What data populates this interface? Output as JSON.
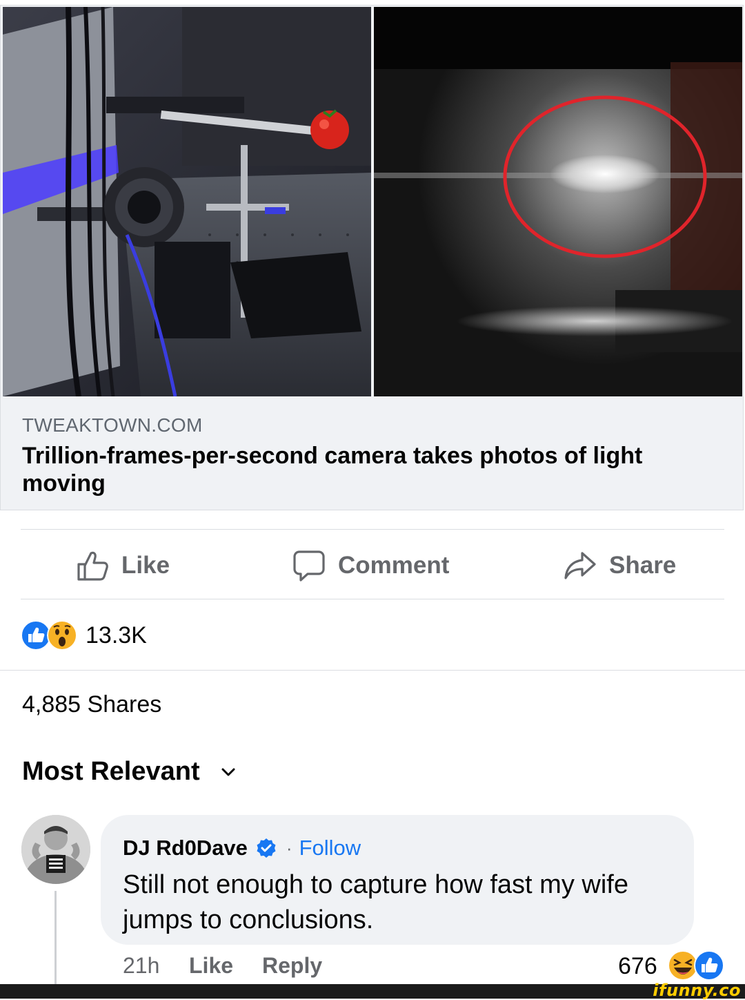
{
  "preview": {
    "domain": "TWEAKTOWN.COM",
    "headline": "Trillion-frames-per-second camera takes photos of light moving",
    "left_image": "lab camera setup with tomato",
    "right_image": "light pulse circled in red",
    "info_icon": "info-icon"
  },
  "actions": {
    "like": "Like",
    "comment": "Comment",
    "share": "Share"
  },
  "reactions": {
    "icons": [
      "like-reaction-icon",
      "wow-reaction-icon"
    ],
    "count": "13.3K"
  },
  "shares": "4,885 Shares",
  "sort": {
    "label": "Most Relevant"
  },
  "comment": {
    "author": "DJ Rd0Dave",
    "verified": true,
    "separator": "·",
    "follow": "Follow",
    "text": "Still not enough to capture how fast my wife jumps to conclusions.",
    "time": "21h",
    "like": "Like",
    "reply": "Reply",
    "reaction_count": "676",
    "reaction_icons": [
      "haha-reaction-icon",
      "like-reaction-icon"
    ]
  },
  "watermark": "ifunny.co",
  "colors": {
    "accent": "#1877f2",
    "muted_text": "#65676b",
    "card_bg": "#f0f2f5",
    "circle_red": "#e0242b"
  }
}
